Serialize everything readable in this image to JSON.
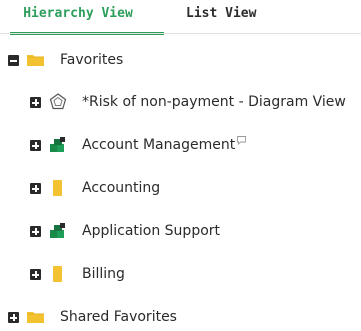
{
  "tabs": [
    {
      "label": "Hierarchy View",
      "active": true
    },
    {
      "label": "List View",
      "active": false
    }
  ],
  "colors": {
    "accent": "#2e9e5b",
    "folder": "#f2c230",
    "text": "#2b2b2b"
  },
  "tree": {
    "favorites": {
      "label": "Favorites",
      "state": "expanded",
      "icon": "folder-icon",
      "children": [
        {
          "label": "*Risk of non-payment - Diagram View",
          "icon": "diagram-view-icon",
          "state": "collapsed"
        },
        {
          "label": "Account Management",
          "icon": "application-icon",
          "state": "collapsed",
          "has_comment": true
        },
        {
          "label": "Accounting",
          "icon": "document-icon",
          "state": "collapsed"
        },
        {
          "label": "Application Support",
          "icon": "application-icon",
          "state": "collapsed"
        },
        {
          "label": "Billing",
          "icon": "document-icon",
          "state": "collapsed"
        }
      ]
    },
    "shared_favorites": {
      "label": "Shared Favorites",
      "state": "collapsed",
      "icon": "folder-icon"
    }
  }
}
